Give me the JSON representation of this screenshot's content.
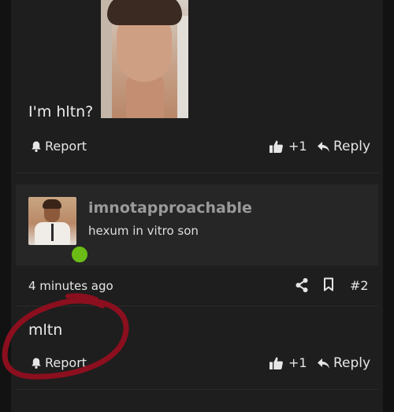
{
  "posts": [
    {
      "text": "I'm hltn?",
      "report_label": "Report",
      "like_count": "+1",
      "reply_label": "Reply"
    },
    {
      "author": {
        "username": "imnotapproachable",
        "tagline": "hexum in vitro son",
        "online_status_color": "#6bbd16"
      },
      "timestamp": "4 minutes ago",
      "post_number": "#2",
      "text": "mltn",
      "report_label": "Report",
      "like_count": "+1",
      "reply_label": "Reply"
    }
  ],
  "icons": [
    "bell-icon",
    "thumbs-up-icon",
    "reply-arrow-icon",
    "share-icon",
    "bookmark-icon"
  ],
  "colors": {
    "background": "#121212",
    "panel": "#1e1e1e",
    "card": "#262626",
    "annotation": "#8b0f1e",
    "text": "#e6e6e6",
    "username": "#9a9a9a"
  }
}
